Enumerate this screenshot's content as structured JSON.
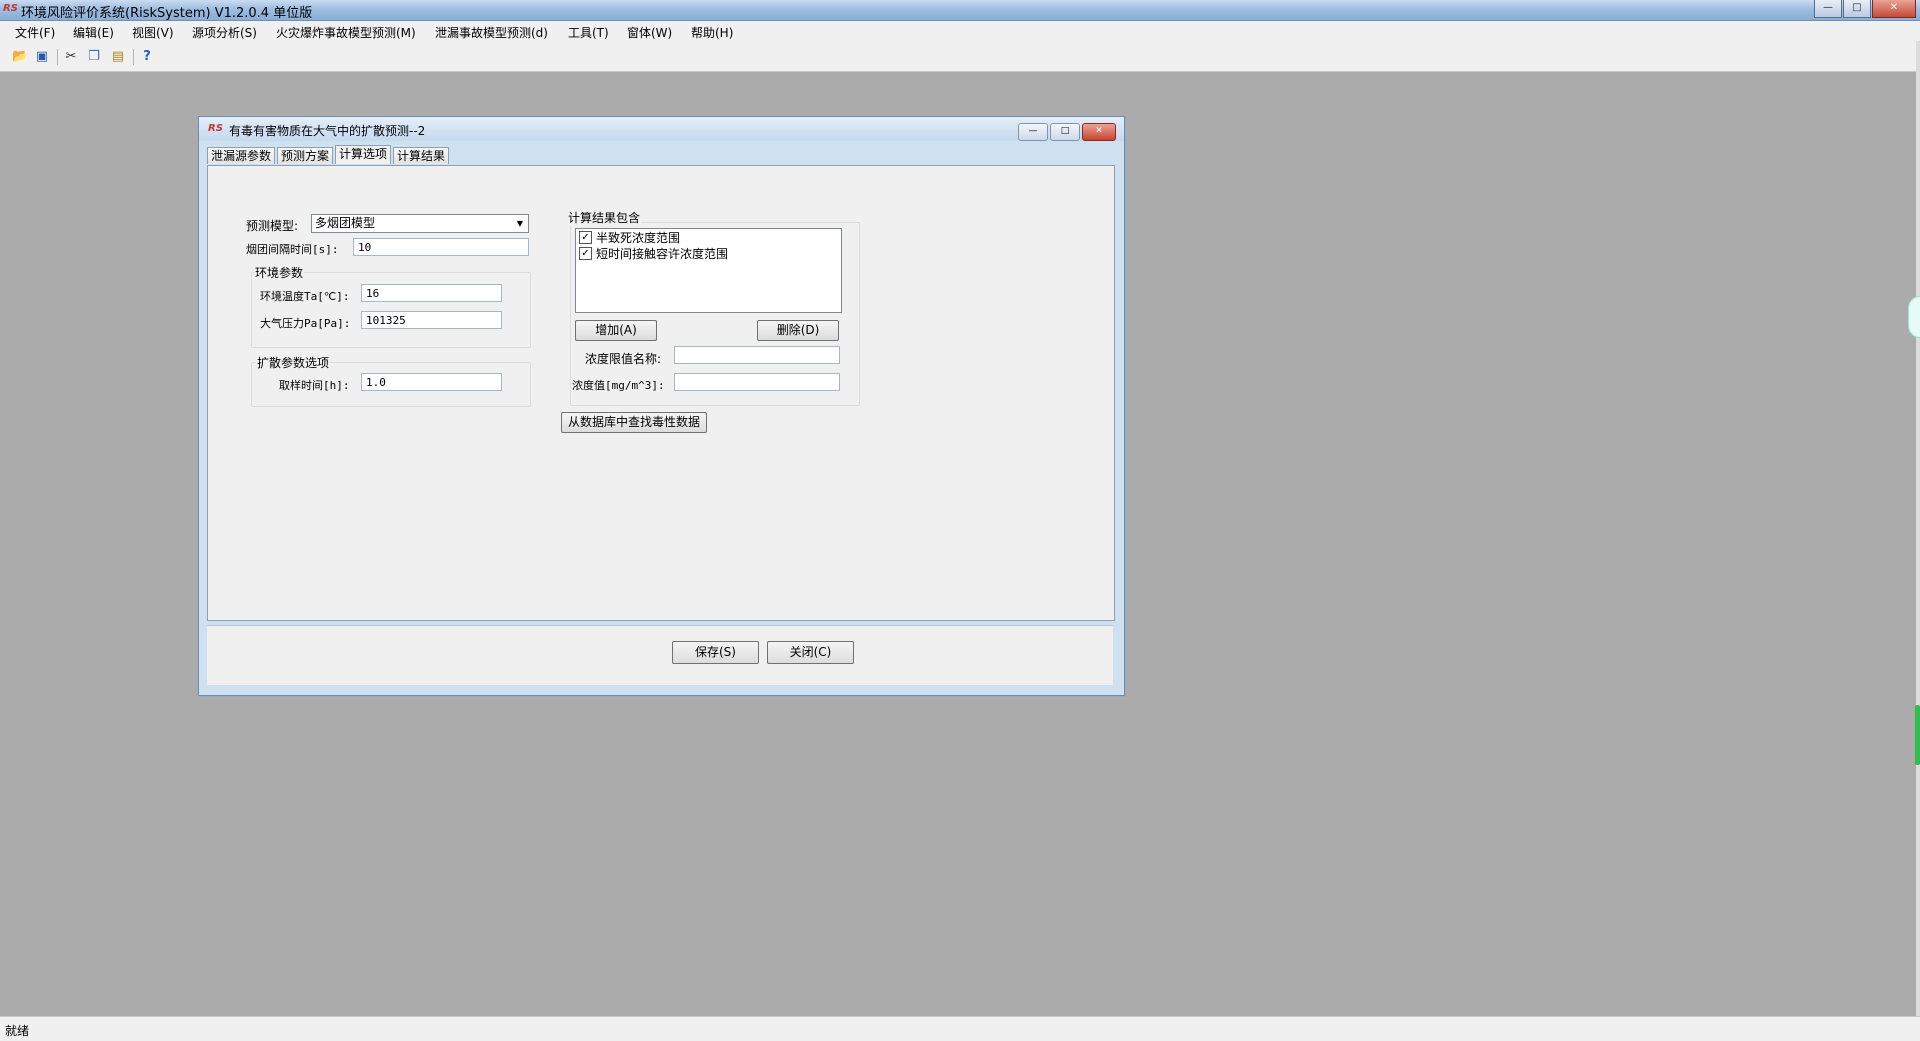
{
  "window": {
    "title": "环境风险评价系统(RiskSystem) V1.2.0.4 单位版",
    "app_icon": "RS",
    "controls": {
      "minimize": "—",
      "maximize": "□",
      "close": "✕"
    }
  },
  "menu": [
    "文件(F)",
    "编辑(E)",
    "视图(V)",
    "源项分析(S)",
    "火灾爆炸事故模型预测(M)",
    "泄漏事故模型预测(d)",
    "工具(T)",
    "窗体(W)",
    "帮助(H)"
  ],
  "toolbar_icons": [
    "open-icon",
    "save-icon",
    "cut-icon",
    "copy-icon",
    "paste-icon",
    "help-icon"
  ],
  "dialog": {
    "title": "有毒有害物质在大气中的扩散预测--2",
    "tabs": [
      "泄漏源参数",
      "预测方案",
      "计算选项",
      "计算结果"
    ],
    "active_tab": "计算选项",
    "form": {
      "model_label": "预测模型:",
      "model_value": "多烟团模型",
      "interval_label": "烟团间隔时间[s]:",
      "interval_value": "10",
      "env_group": "环境参数",
      "temp_label": "环境温度Ta[℃]:",
      "temp_value": "16",
      "pressure_label": "大气压力Pa[Pa]:",
      "pressure_value": "101325",
      "diffusion_group": "扩散参数选项",
      "sampling_label": "取样时间[h]:",
      "sampling_value": "1.0"
    },
    "results": {
      "group": "计算结果包含",
      "items": [
        {
          "label": "半致死浓度范围",
          "checked": true
        },
        {
          "label": "短时间接触容许浓度范围",
          "checked": true
        }
      ],
      "add_button": "增加(A)",
      "delete_button": "删除(D)",
      "limit_name_label": "浓度限值名称:",
      "limit_name_value": "",
      "conc_label": "浓度值[mg/m^3]:",
      "conc_value": ""
    },
    "db_button": "从数据库中查找毒性数据",
    "save_button": "保存(S)",
    "close_button": "关闭(C)"
  },
  "status": "就绪"
}
